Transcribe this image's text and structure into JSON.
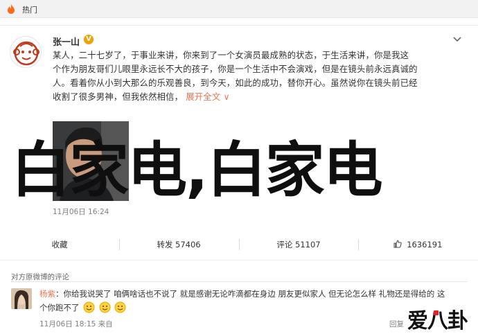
{
  "topbar": {
    "label": "热门",
    "icon": "fire-icon"
  },
  "post": {
    "username": "张一山",
    "vip_badge": "V",
    "lines": [
      "某人，二十七岁了，于事业来讲，你来到了一个女演员最成熟的状态，于生活来讲，你是我这",
      "个作为朋友哥们儿眼里永远长不大的孩子，你是一个生活中不会演戏，但是在镜头前永远真诚的",
      "人。看着你从小到大那么的乐观善良，到今天，如此的成功，替你开心。虽然说你在镜头前已经",
      "收割了很多男神，但我依然相信，"
    ],
    "expand_label": "展开全文",
    "expand_glyph": "∨",
    "watermark": "白家电,白家电",
    "time": "11月06日 16:24",
    "from": ""
  },
  "actions": {
    "favorite": "收藏",
    "forward": "转发 57406",
    "comment": "评论 51107",
    "like": "1636191"
  },
  "comments": {
    "header": "对方原微博的评论",
    "item": {
      "name": "杨紫",
      "colon": "：",
      "line1": "你给我说哭了 咱俩啥话也不说了 就是感谢无论咋滴都在身边 朋友更似家人 但无论怎么样 礼物还是得给的 这",
      "line2": "个你跑不了",
      "time": "11月06日 18:15 来自",
      "reply": "回复"
    }
  },
  "brand": {
    "text": "爱八卦"
  },
  "colors": {
    "accent": "#eb7350",
    "vip": "#f2a100",
    "brand_red": "#ec1b24"
  }
}
